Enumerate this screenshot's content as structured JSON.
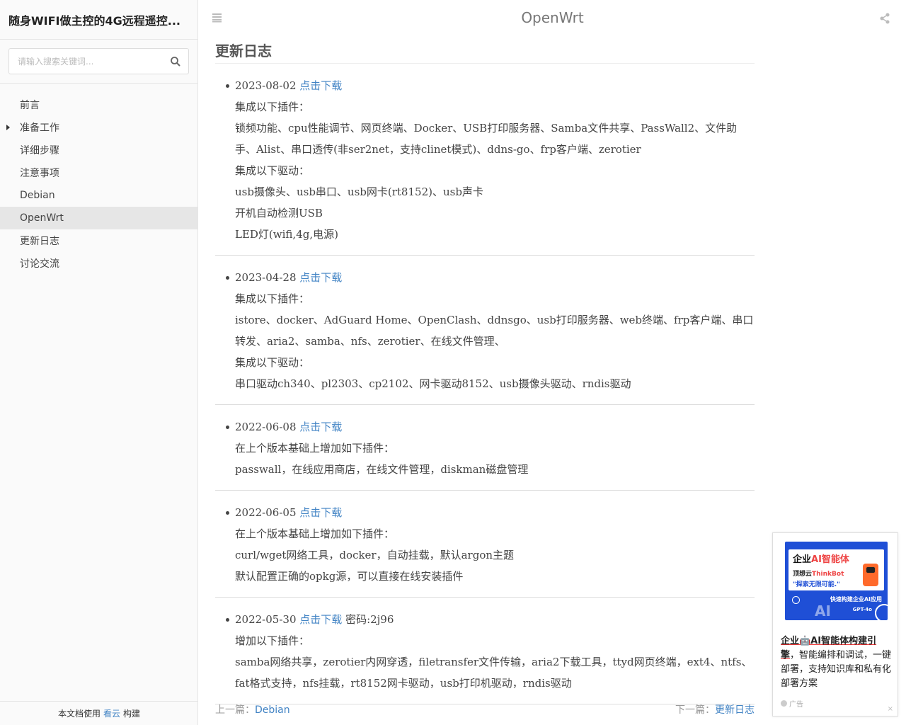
{
  "sidebar": {
    "book_title": "随身WIFI做主控的4G远程遥控...",
    "search_placeholder": "请输入搜索关键词...",
    "items": [
      {
        "label": "前言"
      },
      {
        "label": "准备工作"
      },
      {
        "label": "详细步骤"
      },
      {
        "label": "注意事项"
      },
      {
        "label": "Debian"
      },
      {
        "label": "OpenWrt"
      },
      {
        "label": "更新日志"
      },
      {
        "label": "讨论交流"
      }
    ],
    "footer_prefix": "本文档使用",
    "footer_link": "看云",
    "footer_suffix": "构建"
  },
  "header": {
    "title": "OpenWrt"
  },
  "main": {
    "heading": "更新日志",
    "download_label": "点击下载",
    "entries": [
      {
        "date": "2023-08-02",
        "extra": "",
        "lines": [
          "集成以下插件：",
          "锁频功能、cpu性能调节、网页终端、Docker、USB打印服务器、Samba文件共享、PassWall2、文件助",
          "手、Alist、串口透传(非ser2net，支持clinet模式)、ddns-go、frp客户端、zerotier",
          "集成以下驱动：",
          "usb摄像头、usb串口、usb网卡(rt8152)、usb声卡",
          "开机自动检测USB",
          "LED灯(wifi,4g,电源)"
        ]
      },
      {
        "date": "2023-04-28",
        "extra": "",
        "lines": [
          "集成以下插件：",
          "istore、docker、AdGuard Home、OpenClash、ddnsgo、usb打印服务器、web终端、frp客户端、串口",
          "转发、aria2、samba、nfs、zerotier、在线文件管理、",
          "集成以下驱动：",
          "串口驱动ch340、pl2303、cp2102、网卡驱动8152、usb摄像头驱动、rndis驱动"
        ]
      },
      {
        "date": "2022-06-08",
        "extra": "",
        "lines": [
          "在上个版本基础上增加如下插件：",
          "passwall，在线应用商店，在线文件管理，diskman磁盘管理"
        ]
      },
      {
        "date": "2022-06-05",
        "extra": "",
        "lines": [
          "在上个版本基础上增加如下插件：",
          "curl/wget网络工具，docker，自动挂载，默认argon主题",
          "默认配置正确的opkg源，可以直接在线安装插件"
        ]
      },
      {
        "date": "2022-05-30",
        "extra": "密码:2j96",
        "lines": [
          "增加以下插件：",
          "samba网络共享，zerotier内网穿透，filetransfer文件传输，aria2下载工具，ttyd网页终端，ext4、ntfs、",
          "fat格式支持，nfs挂载，rt8152网卡驱动，usb打印机驱动，rndis驱动"
        ]
      }
    ]
  },
  "pager": {
    "prev_label": "上一篇：",
    "prev_link": "Debian",
    "next_label": "下一篇：",
    "next_link": "更新日志"
  },
  "ad": {
    "banner_title_prefix": "企业",
    "banner_title_accent": "AI智能体",
    "banner_sub1_prefix": "顶想云",
    "banner_sub1_accent": "ThinkBot",
    "banner_sub2": "\"探索无限可能.\"",
    "banner_foot": "快速构建企业AI应用",
    "banner_model": "GPT-4o",
    "banner_ai": "AI",
    "text_highlight": "企业🤖AI智能体构建引擎",
    "text_rest": "，智能编排和调试，一键部署，支持知识库和私有化部署方案",
    "label": "广告",
    "close": "×"
  }
}
